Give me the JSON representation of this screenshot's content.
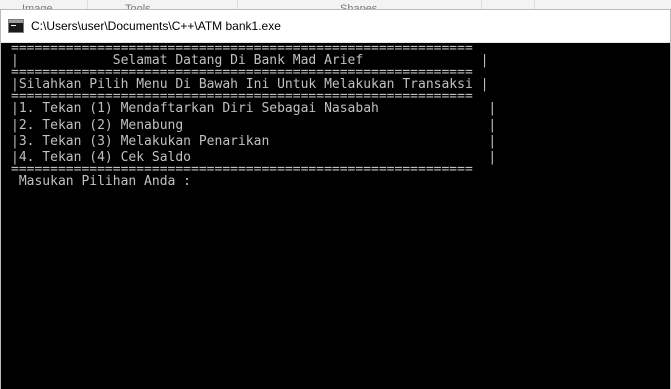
{
  "background_app": {
    "menu": [
      "Image",
      "Tools",
      "Shapes"
    ]
  },
  "window": {
    "title": "C:\\Users\\user\\Documents\\C++\\ATM bank1.exe",
    "icon": "console-app-icon"
  },
  "console": {
    "separator": "===========================================================",
    "welcome": "|            Selamat Datang Di Bank Mad Arief               |",
    "instruction": "|Silahkan Pilih Menu Di Bawah Ini Untuk Melakukan Transaksi |",
    "menu": [
      "|1. Tekan (1) Mendaftarkan Diri Sebagai Nasabah              |",
      "|2. Tekan (2) Menabung                                       |",
      "|3. Tekan (3) Melakukan Penarikan                            |",
      "|4. Tekan (4) Cek Saldo                                      |"
    ],
    "prompt": " Masukan Pilihan Anda : "
  }
}
